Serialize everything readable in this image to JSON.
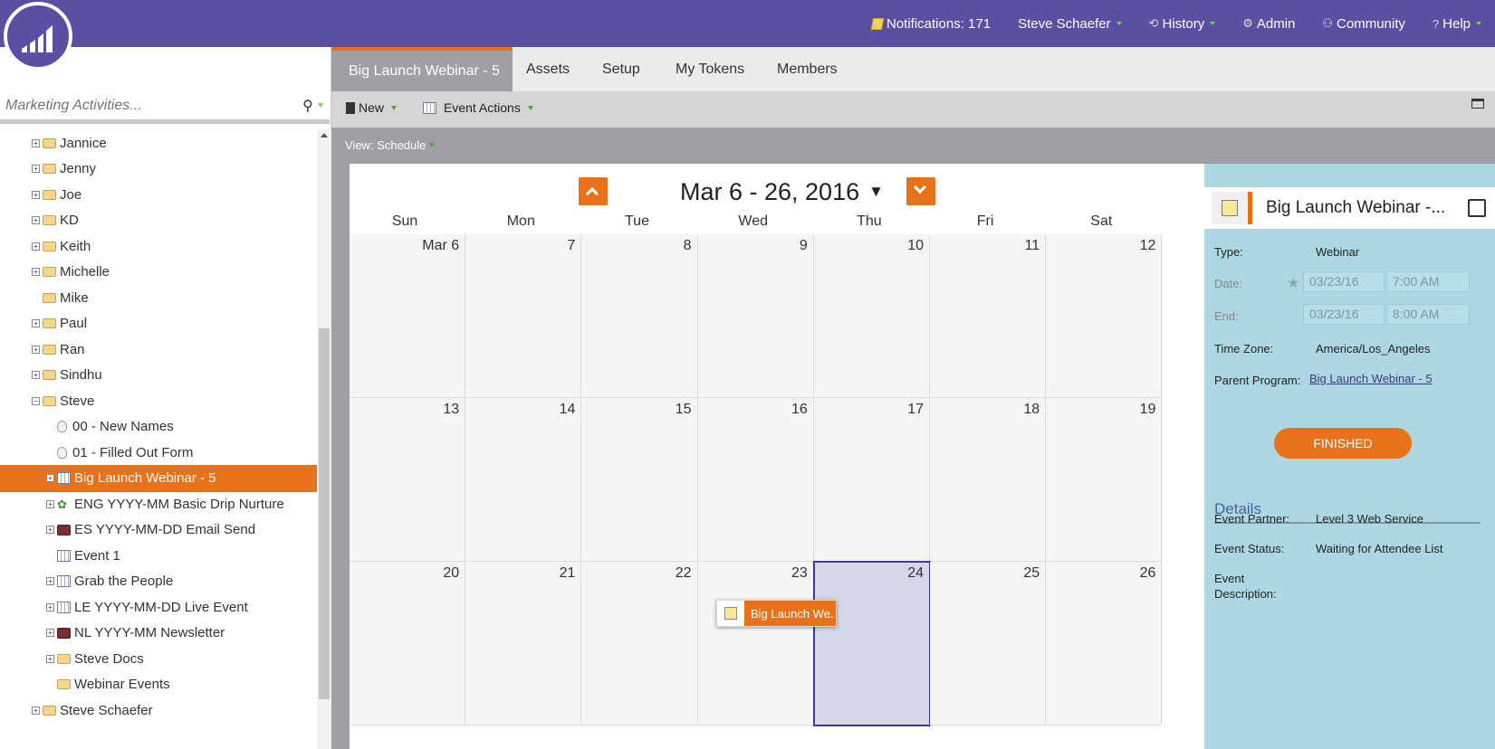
{
  "topnav": {
    "notifications": "Notifications: 171",
    "user": "Steve Schaefer",
    "history": "History",
    "admin": "Admin",
    "community": "Community",
    "help": "Help"
  },
  "sidebar": {
    "search_placeholder": "Marketing Activities...",
    "items": [
      {
        "label": "Jannice",
        "type": "folder",
        "indent": 1,
        "expandable": true
      },
      {
        "label": "Jenny",
        "type": "folder",
        "indent": 1,
        "expandable": true
      },
      {
        "label": "Joe",
        "type": "folder",
        "indent": 1,
        "expandable": true
      },
      {
        "label": "KD",
        "type": "folder",
        "indent": 1,
        "expandable": true
      },
      {
        "label": "Keith",
        "type": "folder",
        "indent": 1,
        "expandable": true
      },
      {
        "label": "Michelle",
        "type": "folder",
        "indent": 1,
        "expandable": true
      },
      {
        "label": "Mike",
        "type": "folder",
        "indent": 1,
        "expandable": false
      },
      {
        "label": "Paul",
        "type": "folder",
        "indent": 1,
        "expandable": true
      },
      {
        "label": "Ran",
        "type": "folder",
        "indent": 1,
        "expandable": true
      },
      {
        "label": "Sindhu",
        "type": "folder",
        "indent": 1,
        "expandable": true
      },
      {
        "label": "Steve",
        "type": "folder",
        "indent": 1,
        "expandable": true,
        "expanded": true
      },
      {
        "label": "00 - New Names",
        "type": "bulb",
        "indent": 2,
        "expandable": false
      },
      {
        "label": "01 - Filled Out Form",
        "type": "bulb",
        "indent": 2,
        "expandable": false
      },
      {
        "label": "Big Launch Webinar - 5",
        "type": "event",
        "indent": 2,
        "expandable": true,
        "selected": true
      },
      {
        "label": "ENG YYYY-MM Basic Drip Nurture",
        "type": "nurture",
        "indent": 2,
        "expandable": true
      },
      {
        "label": "ES YYYY-MM-DD Email Send",
        "type": "email",
        "indent": 2,
        "expandable": true
      },
      {
        "label": "Event 1",
        "type": "event",
        "indent": 2,
        "expandable": false
      },
      {
        "label": "Grab the People",
        "type": "event",
        "indent": 2,
        "expandable": true
      },
      {
        "label": "LE YYYY-MM-DD Live Event",
        "type": "event",
        "indent": 2,
        "expandable": true
      },
      {
        "label": "NL YYYY-MM Newsletter",
        "type": "email",
        "indent": 2,
        "expandable": true
      },
      {
        "label": "Steve Docs",
        "type": "folder",
        "indent": 2,
        "expandable": true
      },
      {
        "label": "Webinar Events",
        "type": "folder",
        "indent": 2,
        "expandable": false
      },
      {
        "label": "Steve Schaefer",
        "type": "folder",
        "indent": 1,
        "expandable": true
      }
    ]
  },
  "tabs": [
    "Big Launch Webinar - 5",
    "Assets",
    "Setup",
    "My Tokens",
    "Members"
  ],
  "toolbar": {
    "new_label": "New",
    "event_actions_label": "Event Actions"
  },
  "view": {
    "label": "View: Schedule"
  },
  "calendar": {
    "range_title": "Mar 6 - 26, 2016",
    "days_of_week": [
      "Sun",
      "Mon",
      "Tue",
      "Wed",
      "Thu",
      "Fri",
      "Sat"
    ],
    "weeks": [
      [
        "Mar 6",
        "7",
        "8",
        "9",
        "10",
        "11",
        "12"
      ],
      [
        "13",
        "14",
        "15",
        "16",
        "17",
        "18",
        "19"
      ],
      [
        "20",
        "21",
        "22",
        "23",
        "24",
        "25",
        "26"
      ]
    ],
    "today": "24",
    "event_chip": "Big Launch We..."
  },
  "detail": {
    "title": "Big Launch Webinar -...",
    "type_label": "Type:",
    "type_value": "Webinar",
    "date_label": "Date:",
    "date_value": "03/23/16",
    "date_time": "7:00 AM",
    "end_label": "End:",
    "end_value": "03/23/16",
    "end_time": "8:00 AM",
    "timezone_label": "Time Zone:",
    "timezone_value": "America/Los_Angeles",
    "parent_label": "Parent Program:",
    "parent_value": "Big Launch Webinar - 5",
    "status_button": "FINISHED",
    "details_heading": "Details",
    "partner_label": "Event Partner:",
    "partner_value": "Level 3 Web Service",
    "status_label": "Event Status:",
    "status_value": "Waiting for Attendee List",
    "description_label_1": "Event",
    "description_label_2": "Description:"
  },
  "colors": {
    "brand": "#5a4fa3",
    "accent": "#e8721c",
    "panel": "#add8e3",
    "today": "#d8d7ea"
  }
}
